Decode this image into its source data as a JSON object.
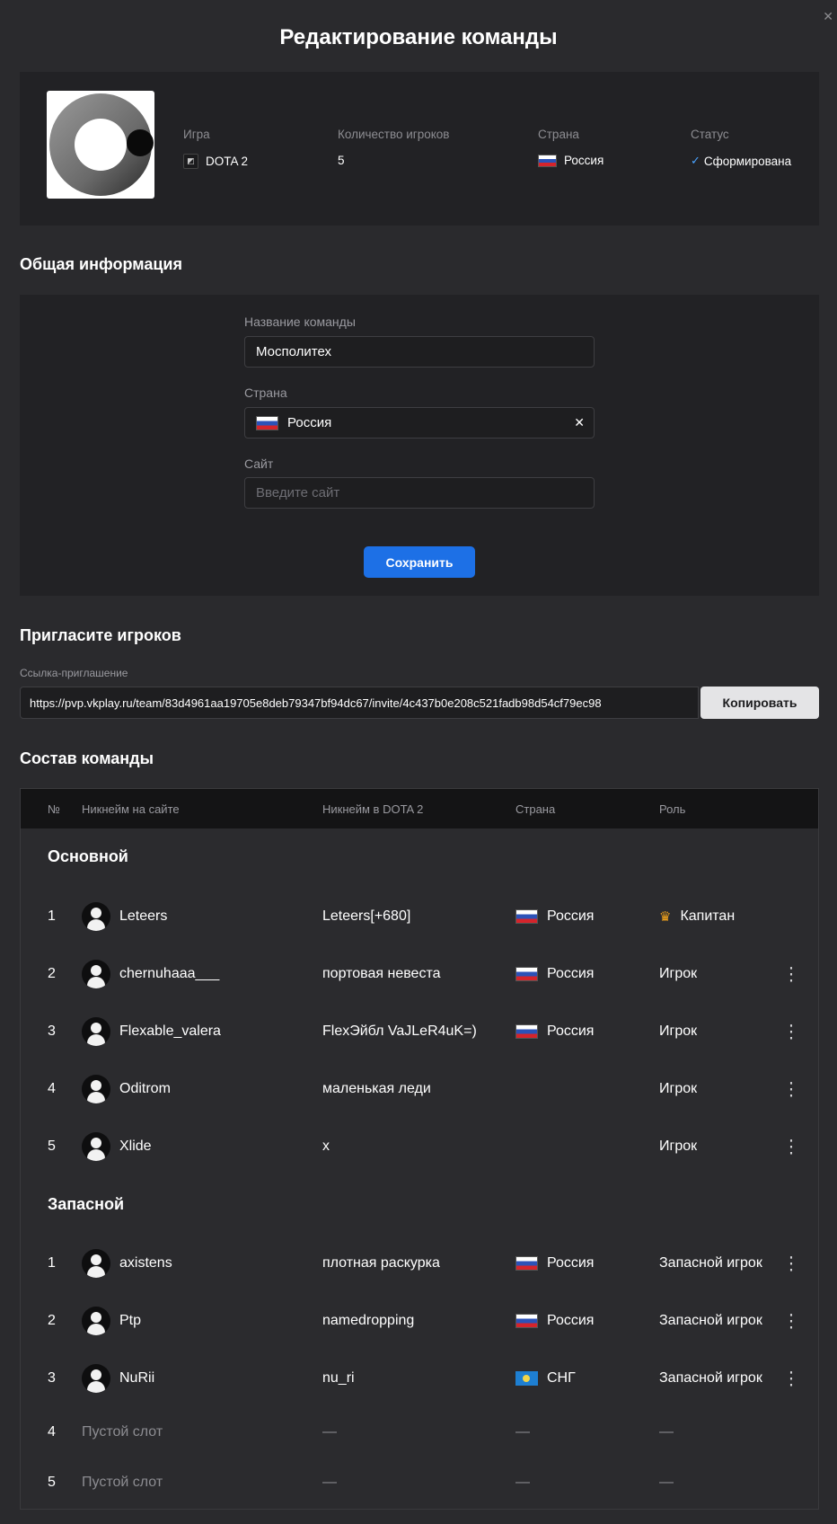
{
  "page": {
    "title": "Редактирование команды"
  },
  "team": {
    "labels": {
      "game": "Игра",
      "players_count": "Количество игроков",
      "country": "Страна",
      "status": "Статус"
    },
    "game": "DOTA 2",
    "players_count": "5",
    "country": "Россия",
    "status": "Сформирована"
  },
  "general": {
    "title": "Общая информация",
    "name_label": "Название команды",
    "name_value": "Мосполитех",
    "country_label": "Страна",
    "country_value": "Россия",
    "site_label": "Сайт",
    "site_placeholder": "Введите сайт",
    "save_label": "Сохранить"
  },
  "invite": {
    "title": "Пригласите игроков",
    "link_label": "Ссылка-приглашение",
    "link_value": "https://pvp.vkplay.ru/team/83d4961aa19705e8deb79347bf94dc67/invite/4c437b0e208c521fadb98d54cf79ec98",
    "copy_label": "Копировать"
  },
  "roster": {
    "title": "Состав команды",
    "headers": {
      "num": "№",
      "nick": "Никнейм на сайте",
      "game_nick": "Никнейм в DOTA 2",
      "country": "Страна",
      "role": "Роль"
    },
    "main_title": "Основной",
    "main": [
      {
        "num": "1",
        "nick": "Leteers",
        "game_nick": "Leteers[+680]",
        "country": "Россия",
        "role": "Капитан"
      },
      {
        "num": "2",
        "nick": "chernuhaaa___",
        "game_nick": "портовая невеста",
        "country": "Россия",
        "role": "Игрок"
      },
      {
        "num": "3",
        "nick": "Flexable_valera",
        "game_nick": "FlexЭйбл VaJLeR4uK=)",
        "country": "Россия",
        "role": "Игрок"
      },
      {
        "num": "4",
        "nick": "Oditrom",
        "game_nick": "маленькая леди",
        "country": "",
        "role": "Игрок"
      },
      {
        "num": "5",
        "nick": "Xlide",
        "game_nick": "x",
        "country": "",
        "role": "Игрок"
      }
    ],
    "reserve_title": "Запасной",
    "reserve": [
      {
        "num": "1",
        "nick": "axistens",
        "game_nick": "плотная раскурка",
        "country": "Россия",
        "role": "Запасной игрок"
      },
      {
        "num": "2",
        "nick": "Ptp",
        "game_nick": "namedropping",
        "country": "Россия",
        "role": "Запасной игрок"
      },
      {
        "num": "3",
        "nick": "NuRii",
        "game_nick": "nu_ri",
        "country": "СНГ",
        "role": "Запасной игрок"
      },
      {
        "num": "4",
        "nick": "Пустой слот",
        "game_nick": "—",
        "country": "—",
        "role": "—"
      },
      {
        "num": "5",
        "nick": "Пустой слот",
        "game_nick": "—",
        "country": "—",
        "role": "—"
      }
    ]
  }
}
